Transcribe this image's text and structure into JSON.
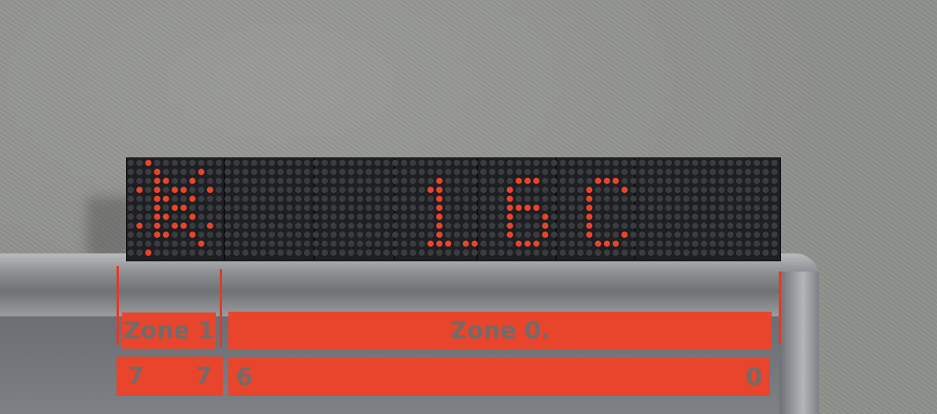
{
  "zones": {
    "zone1_label": "Zone 1",
    "zone0_label": "Zone 0.",
    "zone1_start": "7",
    "zone1_end": "7",
    "zone0_start": "6",
    "zone0_end": "0"
  },
  "display": {
    "led_color": "#e8452c",
    "off_led_color": "#3a3c40"
  }
}
